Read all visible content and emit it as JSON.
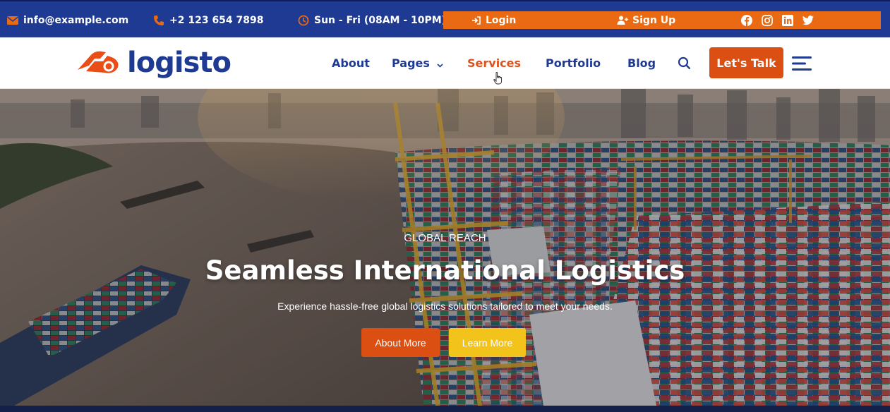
{
  "topbar": {
    "email": "info@example.com",
    "phone": "+2 123 654 7898",
    "hours": "Sun - Fri (08AM - 10PM)",
    "login_label": "Login",
    "signup_label": "Sign Up",
    "social_icons": [
      "facebook-icon",
      "instagram-icon",
      "linkedin-icon",
      "twitter-icon"
    ]
  },
  "header": {
    "logo_text": "logisto",
    "nav": {
      "about": "About",
      "pages": "Pages",
      "services": "Services",
      "portfolio": "Portfolio",
      "blog": "Blog"
    },
    "active_nav": "Services",
    "cta_label": "Let's Talk"
  },
  "hero": {
    "eyebrow": "GLOBAL REACH",
    "title": "Seamless International Logistics",
    "subtitle": "Experience hassle-free global logistics solutions tailored to meet your needs.",
    "primary_button": "About More",
    "secondary_button": "Learn More"
  },
  "colors": {
    "brand_blue": "#1f3a93",
    "brand_orange": "#dc4f12",
    "topbar_orange": "#ea6a14",
    "accent_yellow": "#f2c31b"
  }
}
